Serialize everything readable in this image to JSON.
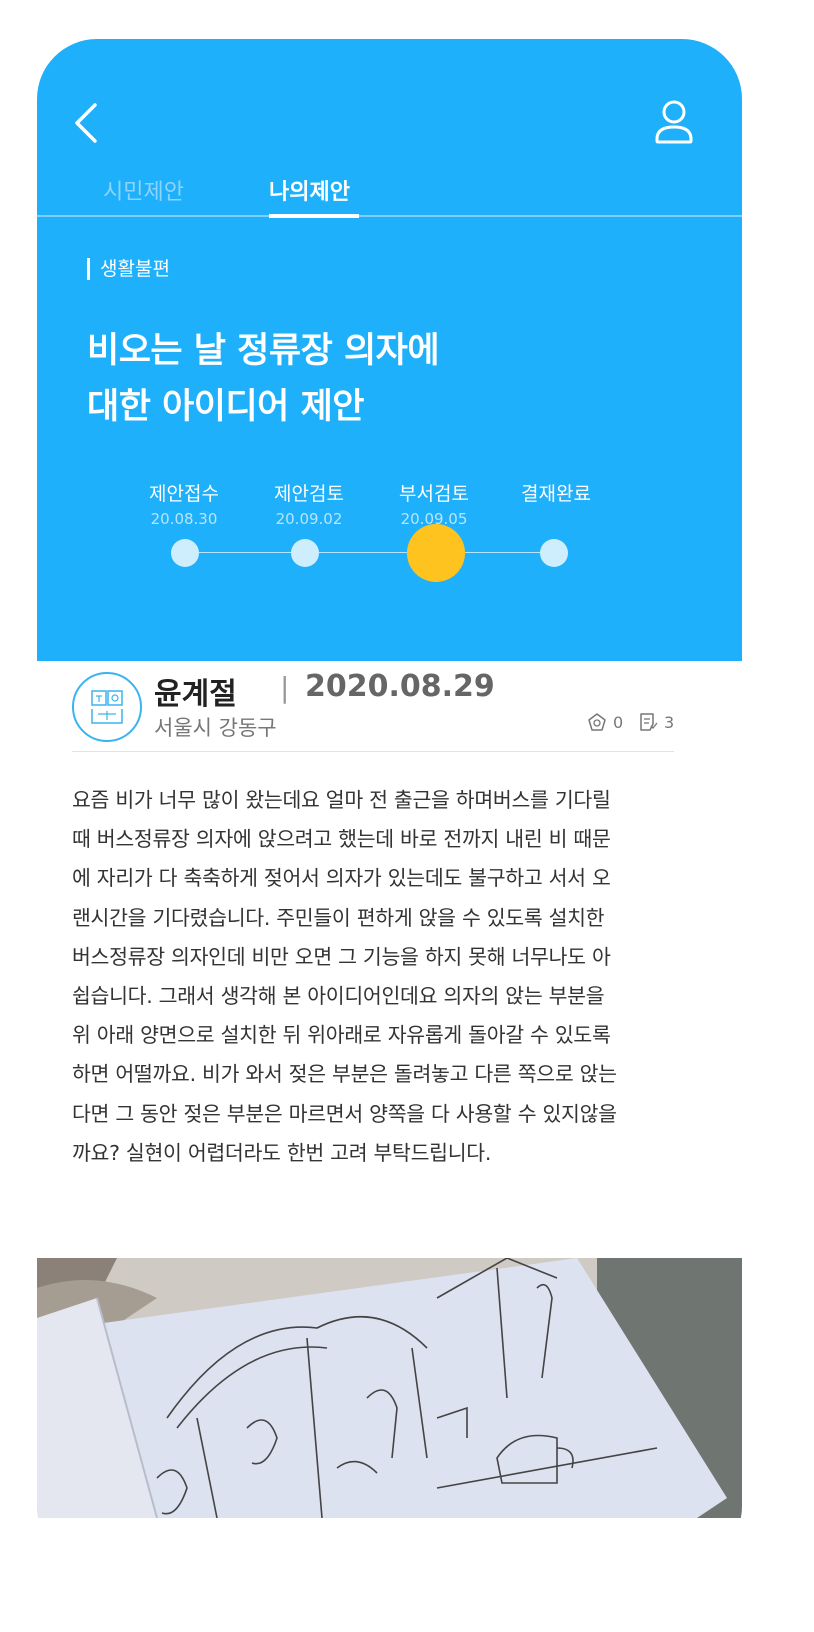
{
  "header": {
    "tabs": [
      {
        "label": "시민제안",
        "active": false
      },
      {
        "label": "나의제안",
        "active": true
      }
    ],
    "back_icon": "chevron-left-icon",
    "user_icon": "user-icon"
  },
  "proposal": {
    "category": "생활불편",
    "title": "비오는 날 정류장 의자에\n대한 아이디어 제안",
    "steps": [
      {
        "label": "제안접수",
        "date": "20.08.30"
      },
      {
        "label": "제안검토",
        "date": "20.09.02"
      },
      {
        "label": "부서검토",
        "date": "20.09.05"
      },
      {
        "label": "결재완료",
        "date": ""
      }
    ],
    "current_step": 3
  },
  "author": {
    "name": "윤계절",
    "separator": "|",
    "date": "2020.08.29",
    "district": "서울시 강동구",
    "likes": "0",
    "comments": "3"
  },
  "content": {
    "body": "요즘 비가 너무 많이 왔는데요 얼마 전 출근을 하며버스를 기다릴\n때 버스정류장 의자에 앉으려고 했는데 바로 전까지 내린 비 때문\n에 자리가 다 축축하게 젖어서 의자가 있는데도 불구하고 서서 오\n랜시간을 기다렸습니다. 주민들이 편하게 앉을 수 있도록 설치한\n버스정류장 의자인데 비만 오면 그 기능을 하지 못해 너무나도 아\n쉽습니다. 그래서 생각해 본 아이디어인데요  의자의 앉는 부분을\n위 아래 양면으로 설치한 뒤 위아래로 자유롭게 돌아갈 수 있도록\n하면 어떨까요. 비가 와서 젖은 부분은 돌려놓고 다른 쪽으로 앉는\n다면 그 동안 젖은 부분은 마르면서 양쪽을 다 사용할 수 있지않을\n까요? 실현이 어렵더라도 한번 고려 부탁드립니다."
  },
  "colors": {
    "primary": "#1fb0fb",
    "current_step": "#ffc31f",
    "step_dot": "#cfeefd"
  }
}
